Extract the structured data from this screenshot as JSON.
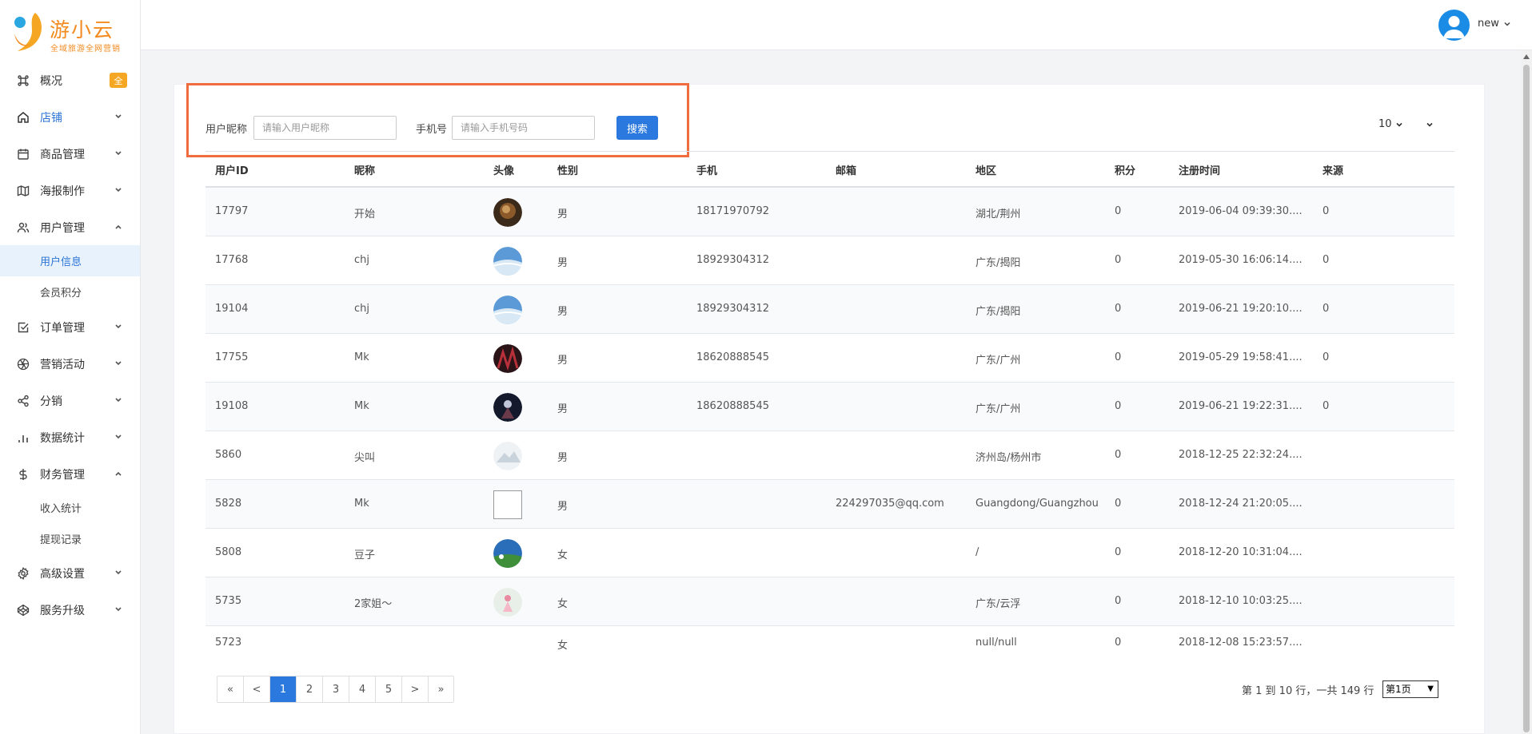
{
  "brand": {
    "name": "游小云",
    "slogan": "全域旅游全网营销"
  },
  "sidebar": {
    "items": [
      {
        "label": "概况",
        "badge": "全"
      },
      {
        "label": "店铺"
      },
      {
        "label": "商品管理"
      },
      {
        "label": "海报制作"
      },
      {
        "label": "用户管理",
        "children": [
          "用户信息",
          "会员积分"
        ]
      },
      {
        "label": "订单管理"
      },
      {
        "label": "营销活动"
      },
      {
        "label": "分销"
      },
      {
        "label": "数据统计"
      },
      {
        "label": "财务管理",
        "children": [
          "收入统计",
          "提现记录"
        ]
      },
      {
        "label": "高级设置"
      },
      {
        "label": "服务升级"
      }
    ],
    "active_sub": "用户信息",
    "accent_color": "#2b74d6"
  },
  "header": {
    "username": "new"
  },
  "search": {
    "nickname_label": "用户昵称",
    "nickname_placeholder": "请输入用户昵称",
    "phone_label": "手机号",
    "phone_placeholder": "请输入手机号码",
    "button_label": "搜索",
    "highlight_color": "#ef6c3e"
  },
  "page_size": "10",
  "table": {
    "columns": [
      "用户ID",
      "昵称",
      "头像",
      "性别",
      "手机",
      "邮箱",
      "地区",
      "积分",
      "注册时间",
      "来源"
    ],
    "rows": [
      {
        "id": "17797",
        "nickname": "开始",
        "gender": "男",
        "phone": "18171970792",
        "email": "",
        "region": "湖北/荆州",
        "points": "0",
        "reg_time": "2019-06-04 09:39:30....",
        "source": "0"
      },
      {
        "id": "17768",
        "nickname": "chj",
        "gender": "男",
        "phone": "18929304312",
        "email": "",
        "region": "广东/揭阳",
        "points": "0",
        "reg_time": "2019-05-30 16:06:14....",
        "source": "0"
      },
      {
        "id": "19104",
        "nickname": "chj",
        "gender": "男",
        "phone": "18929304312",
        "email": "",
        "region": "广东/揭阳",
        "points": "0",
        "reg_time": "2019-06-21 19:20:10....",
        "source": "0"
      },
      {
        "id": "17755",
        "nickname": "Mk",
        "gender": "男",
        "phone": "18620888545",
        "email": "",
        "region": "广东/广州",
        "points": "0",
        "reg_time": "2019-05-29 19:58:41....",
        "source": "0"
      },
      {
        "id": "19108",
        "nickname": "Mk",
        "gender": "男",
        "phone": "18620888545",
        "email": "",
        "region": "广东/广州",
        "points": "0",
        "reg_time": "2019-06-21 19:22:31....",
        "source": "0"
      },
      {
        "id": "5860",
        "nickname": "尖叫",
        "gender": "男",
        "phone": "",
        "email": "",
        "region": "济州岛/杨州市",
        "points": "0",
        "reg_time": "2018-12-25 22:32:24....",
        "source": ""
      },
      {
        "id": "5828",
        "nickname": "Mk",
        "gender": "男",
        "phone": "",
        "email": "224297035@qq.com",
        "region": "Guangdong/Guangzhou",
        "points": "0",
        "reg_time": "2018-12-24 21:20:05....",
        "source": ""
      },
      {
        "id": "5808",
        "nickname": "豆子",
        "gender": "女",
        "phone": "",
        "email": "",
        "region": "/",
        "points": "0",
        "reg_time": "2018-12-20 10:31:04....",
        "source": ""
      },
      {
        "id": "5735",
        "nickname": "2家姐～",
        "gender": "女",
        "phone": "",
        "email": "",
        "region": "广东/云浮",
        "points": "0",
        "reg_time": "2018-12-10 10:03:25....",
        "source": ""
      },
      {
        "id": "5723",
        "nickname": "",
        "gender": "女",
        "phone": "",
        "email": "",
        "region": "null/null",
        "points": "0",
        "reg_time": "2018-12-08 15:23:57....",
        "source": ""
      }
    ]
  },
  "pagination": {
    "first": "«",
    "prev": "<",
    "pages": [
      "1",
      "2",
      "3",
      "4",
      "5"
    ],
    "next": ">",
    "last": "»",
    "current": "1",
    "info": "第 1 到 10 行，一共 149 行",
    "select_value": "第1页"
  }
}
